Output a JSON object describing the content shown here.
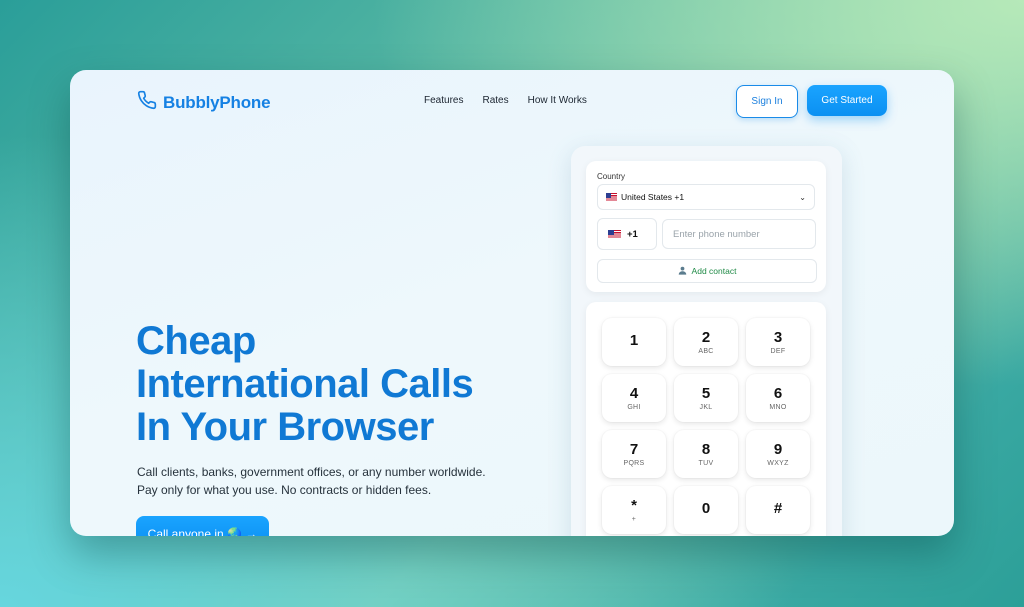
{
  "header": {
    "brand": "BubblyPhone",
    "nav": [
      "Features",
      "Rates",
      "How It Works"
    ],
    "sign_in": "Sign In",
    "get_started": "Get Started"
  },
  "hero": {
    "title_lines": [
      "Cheap",
      "International Calls",
      "In Your Browser"
    ],
    "subtitle_lines": [
      "Call clients, banks, government offices, or any number worldwide.",
      "Pay only for what you use. No contracts or hidden fees."
    ],
    "cta": "Call anyone in 🌏 →"
  },
  "dialer": {
    "country_label": "Country",
    "country_selected": "United States +1",
    "dial_code": "+1",
    "phone_placeholder": "Enter phone number",
    "add_contact": "Add contact",
    "keys": [
      {
        "digit": "1",
        "letters": ""
      },
      {
        "digit": "2",
        "letters": "ABC"
      },
      {
        "digit": "3",
        "letters": "DEF"
      },
      {
        "digit": "4",
        "letters": "GHI"
      },
      {
        "digit": "5",
        "letters": "JKL"
      },
      {
        "digit": "6",
        "letters": "MNO"
      },
      {
        "digit": "7",
        "letters": "PQRS"
      },
      {
        "digit": "8",
        "letters": "TUV"
      },
      {
        "digit": "9",
        "letters": "WXYZ"
      },
      {
        "digit": "*",
        "letters": "+"
      },
      {
        "digit": "0",
        "letters": ""
      },
      {
        "digit": "#",
        "letters": ""
      }
    ]
  },
  "icons": {
    "logo": "phone-icon",
    "add_contact": "user-icon",
    "select": "chevron-down-icon",
    "flag": "us-flag-icon"
  },
  "colors": {
    "brand": "#1681e3",
    "button": "#0b90f2",
    "add_contact": "#1f8a46"
  }
}
